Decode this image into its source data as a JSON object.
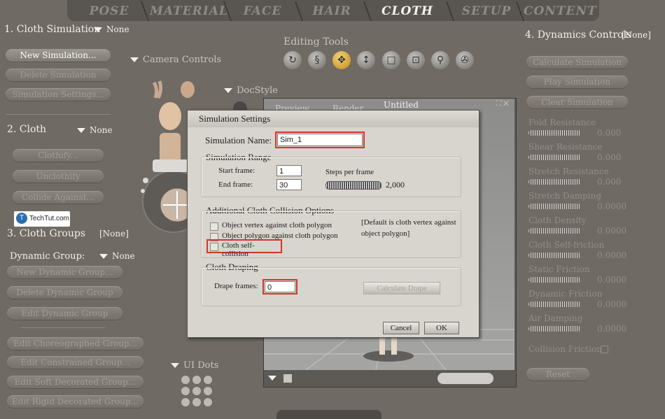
{
  "tabs": [
    "POSE",
    "MATERIAL",
    "FACE",
    "HAIR",
    "CLOTH",
    "SETUP",
    "CONTENT"
  ],
  "active_tab": "CLOTH",
  "cloth_simulation": {
    "header": "1. Cloth Simulation",
    "selected": "None",
    "buttons": [
      "New Simulation...",
      "Delete Simulation",
      "Simulation Settings..."
    ]
  },
  "cloth": {
    "header": "2. Cloth",
    "selected": "None",
    "buttons": [
      "Clothify...",
      "Unclothify",
      "Collide Against..."
    ]
  },
  "cloth_groups": {
    "header": "3. Cloth Groups",
    "selected": "[None]",
    "dynamic_group_label": "Dynamic Group:",
    "dynamic_group_value": "None",
    "buttons": [
      "New Dynamic Group...",
      "Delete Dynamic Group",
      "Edit Dynamic Group"
    ],
    "buttons2": [
      "Edit Choreographed Group...",
      "Edit Constrained Group...",
      "Edit Soft Decorated Group...",
      "Edit Rigid Decorated Group..."
    ]
  },
  "camera_controls": "Camera Controls",
  "docstyle": "DocStyle",
  "editing_tools": "Editing Tools",
  "ui_dots": "UI Dots",
  "watermark": "TechTut.com",
  "document": {
    "tabs": [
      "Preview",
      "Render"
    ],
    "title": "Untitled"
  },
  "dynamics": {
    "header": "4. Dynamics Controls",
    "selected": "[None]",
    "buttons": [
      "Calculate Simulation",
      "Play Simulation",
      "Clear Simulation"
    ],
    "params": [
      {
        "label": "Fold Resistance",
        "value": "0.000"
      },
      {
        "label": "Shear Resistance",
        "value": "0.000"
      },
      {
        "label": "Stretch Resistance",
        "value": "0.000"
      },
      {
        "label": "Stretch Damping",
        "value": "0.0000"
      },
      {
        "label": "Cloth Density",
        "value": "0.0000"
      },
      {
        "label": "Cloth Self-friction",
        "value": "0.0000"
      },
      {
        "label": "Static Friction",
        "value": "0.0000"
      },
      {
        "label": "Dynamic Friction",
        "value": "0.0000"
      },
      {
        "label": "Air Damping",
        "value": "0.0000"
      }
    ],
    "collision_friction": "Collision Friction",
    "reset": "Reset"
  },
  "dialog": {
    "title": "Simulation Settings",
    "name_label": "Simulation Name:",
    "name_value": "Sim_1",
    "range_header": "Simulation Range",
    "start_label": "Start frame:",
    "start_value": "1",
    "end_label": "End frame:",
    "end_value": "30",
    "steps_label": "Steps per frame",
    "steps_value": "2,000",
    "collision_header": "Additional Cloth Collision Options",
    "opt1": "Object vertex against cloth polygon",
    "opt2": "Object polygon against cloth polygon",
    "opt3": "Cloth self-collision",
    "default_note": "[Default is cloth vertex against object polygon]",
    "draping_header": "Cloth Draping",
    "drape_label": "Drape frames:",
    "drape_value": "0",
    "calc_drape": "Calculate Drape",
    "cancel": "Cancel",
    "ok": "OK"
  },
  "colors": {
    "highlight": "#d2372b",
    "background": "#6f6a63",
    "dialog": "#d8d5ce"
  }
}
